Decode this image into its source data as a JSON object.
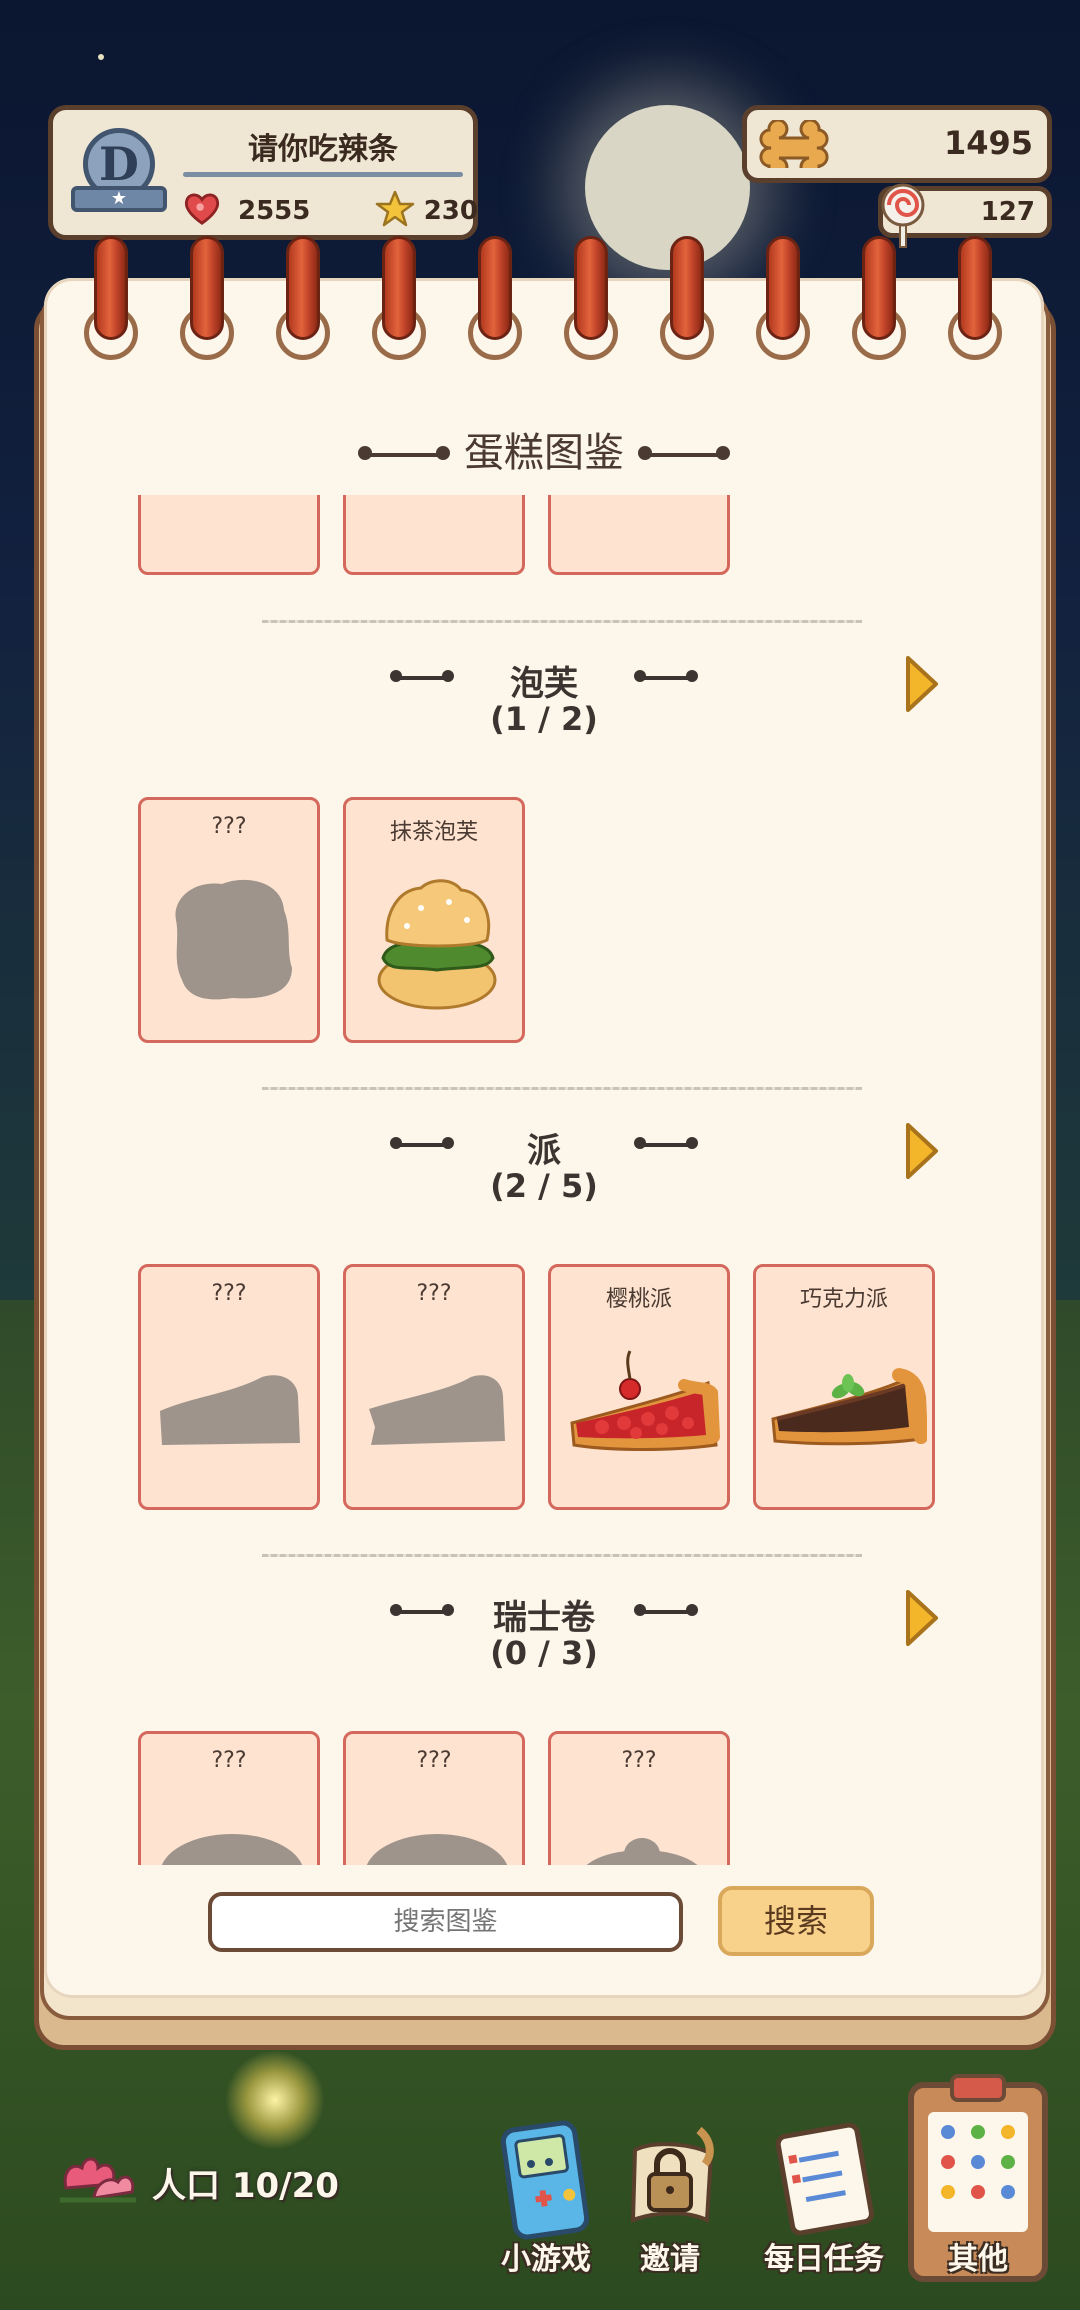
{
  "player": {
    "rank_letter": "D",
    "name": "请你吃辣条",
    "hearts": "2555",
    "stars": "230"
  },
  "currency": {
    "bones": "1495",
    "candy": "127"
  },
  "book": {
    "title": "蛋糕图鉴",
    "sections": [
      {
        "title": "泡芙",
        "count": "(1 / 2)",
        "cards": [
          {
            "name": "???",
            "icon": "locked-silhouette-icon"
          },
          {
            "name": "抹茶泡芙",
            "icon": "matcha-puff-icon"
          }
        ]
      },
      {
        "title": "派",
        "count": "(2 / 5)",
        "cards": [
          {
            "name": "???",
            "icon": "locked-silhouette-icon"
          },
          {
            "name": "???",
            "icon": "locked-silhouette-icon"
          },
          {
            "name": "樱桃派",
            "icon": "cherry-pie-icon"
          },
          {
            "name": "巧克力派",
            "icon": "chocolate-pie-icon"
          }
        ]
      },
      {
        "title": "瑞士卷",
        "count": "(0 / 3)",
        "cards": [
          {
            "name": "???",
            "icon": "locked-silhouette-icon"
          },
          {
            "name": "???",
            "icon": "locked-silhouette-icon"
          },
          {
            "name": "???",
            "icon": "locked-silhouette-icon"
          }
        ]
      }
    ]
  },
  "search": {
    "placeholder": "搜索图鉴",
    "button": "搜索"
  },
  "bottom": {
    "population": "人口 10/20",
    "nav": [
      {
        "label": "小游戏",
        "icon": "gameboy-icon"
      },
      {
        "label": "邀请",
        "icon": "lock-scroll-icon"
      },
      {
        "label": "每日任务",
        "icon": "checklist-icon"
      },
      {
        "label": "其他",
        "icon": "clipboard-icon"
      }
    ]
  }
}
